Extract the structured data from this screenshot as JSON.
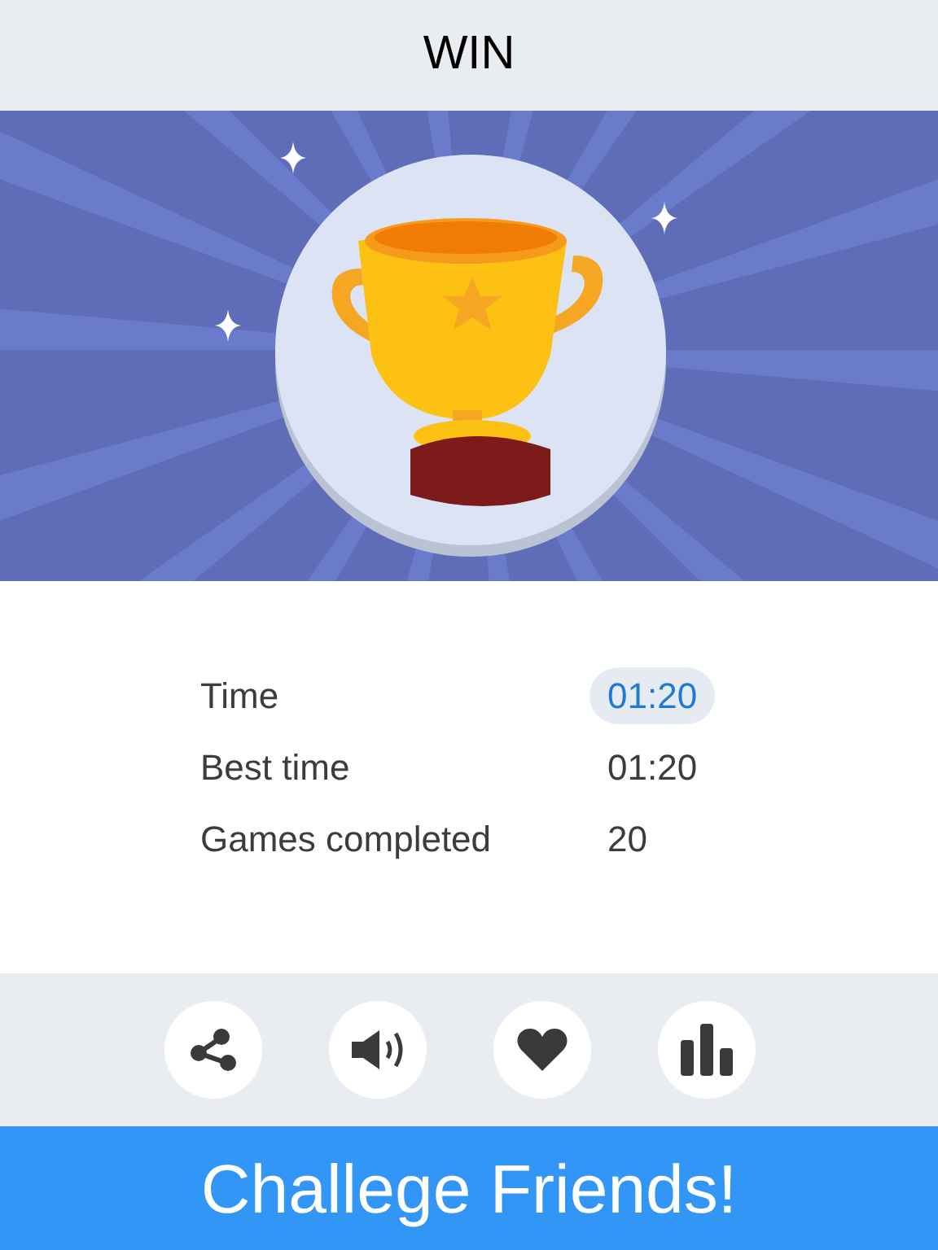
{
  "header": {
    "title": "WIN"
  },
  "stats": [
    {
      "label": "Time",
      "value": "01:20",
      "highlighted": true
    },
    {
      "label": "Best time",
      "value": "01:20",
      "highlighted": false
    },
    {
      "label": "Games completed",
      "value": "20",
      "highlighted": false
    }
  ],
  "toolbar": [
    {
      "kind": "share"
    },
    {
      "kind": "sound"
    },
    {
      "kind": "heart"
    },
    {
      "kind": "chart"
    }
  ],
  "action_button": {
    "label": "Challege Friends!"
  }
}
